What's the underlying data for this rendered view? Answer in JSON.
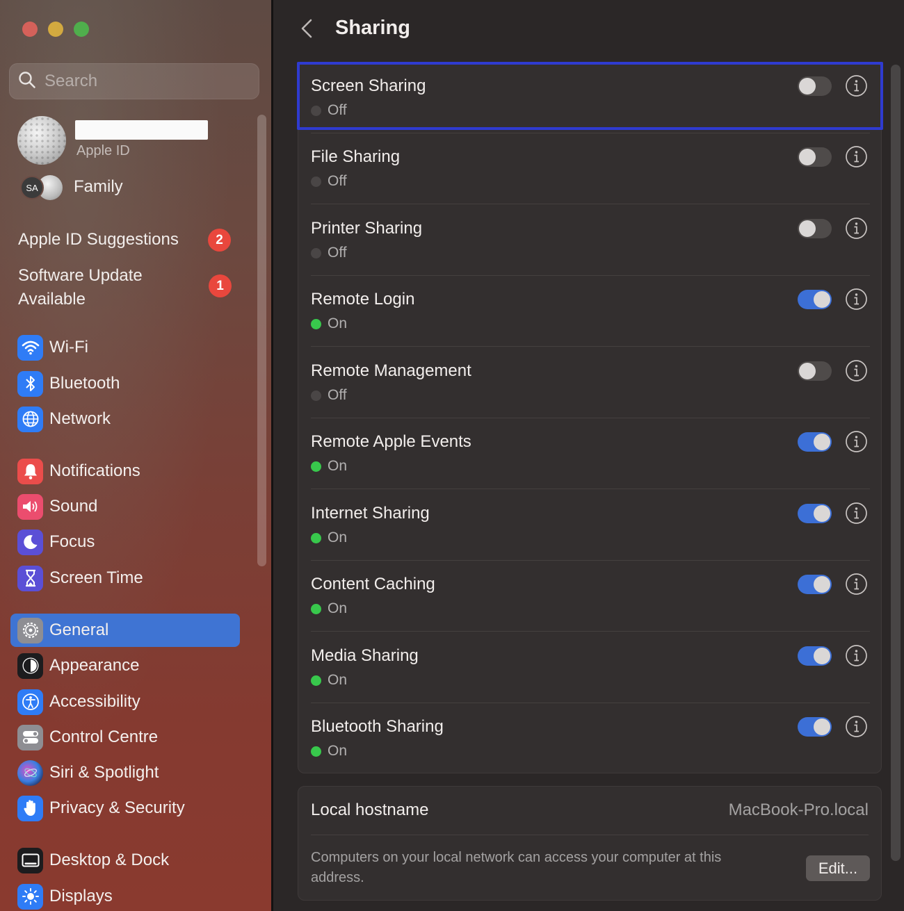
{
  "window": {
    "controls": {
      "close_color": "#ee5b55",
      "minimize_color": "#f3bb2f",
      "zoom_color": "#3fc43f"
    }
  },
  "sidebar": {
    "search": {
      "placeholder": "Search",
      "value": ""
    },
    "account": {
      "subtitle": "Apple ID",
      "family_initials": "SA",
      "family_label": "Family"
    },
    "suggestions": [
      {
        "label": "Apple ID Suggestions",
        "badge": "2"
      },
      {
        "label": "Software Update Available",
        "badge": "1"
      }
    ],
    "items": [
      {
        "label": "Wi-Fi",
        "icon": "wifi-icon",
        "color": "#2f7cf6"
      },
      {
        "label": "Bluetooth",
        "icon": "bluetooth-icon",
        "color": "#2f7cf6"
      },
      {
        "label": "Network",
        "icon": "globe-icon",
        "color": "#2f7cf6"
      },
      {
        "label": "Notifications",
        "icon": "bell-icon",
        "color": "#eb4d4b"
      },
      {
        "label": "Sound",
        "icon": "speaker-icon",
        "color": "#eb4d6e"
      },
      {
        "label": "Focus",
        "icon": "moon-icon",
        "color": "#5b4fd6"
      },
      {
        "label": "Screen Time",
        "icon": "hourglass-icon",
        "color": "#5b4fd6"
      },
      {
        "label": "General",
        "icon": "gear-icon",
        "color": "#8e8e93",
        "selected": true
      },
      {
        "label": "Appearance",
        "icon": "appearance-icon",
        "color": "#1c1c1e"
      },
      {
        "label": "Accessibility",
        "icon": "accessibility-icon",
        "color": "#2f7cf6"
      },
      {
        "label": "Control Centre",
        "icon": "control-centre-icon",
        "color": "#8e8e93"
      },
      {
        "label": "Siri & Spotlight",
        "icon": "siri-icon",
        "color": "#3a3a8c"
      },
      {
        "label": "Privacy & Security",
        "icon": "hand-icon",
        "color": "#2f7cf6"
      },
      {
        "label": "Desktop & Dock",
        "icon": "dock-icon",
        "color": "#1c1c1e"
      },
      {
        "label": "Displays",
        "icon": "sun-icon",
        "color": "#2f7cf6"
      }
    ]
  },
  "main": {
    "title": "Sharing",
    "services": [
      {
        "title": "Screen Sharing",
        "status": "Off",
        "on": false
      },
      {
        "title": "File Sharing",
        "status": "Off",
        "on": false
      },
      {
        "title": "Printer Sharing",
        "status": "Off",
        "on": false
      },
      {
        "title": "Remote Login",
        "status": "On",
        "on": true
      },
      {
        "title": "Remote Management",
        "status": "Off",
        "on": false
      },
      {
        "title": "Remote Apple Events",
        "status": "On",
        "on": true
      },
      {
        "title": "Internet Sharing",
        "status": "On",
        "on": true
      },
      {
        "title": "Content Caching",
        "status": "On",
        "on": true
      },
      {
        "title": "Media Sharing",
        "status": "On",
        "on": true
      },
      {
        "title": "Bluetooth Sharing",
        "status": "On",
        "on": true
      }
    ],
    "hostname": {
      "label": "Local hostname",
      "value": "MacBook-Pro.local",
      "description": "Computers on your local network can access your computer at this address.",
      "edit_label": "Edit..."
    }
  }
}
